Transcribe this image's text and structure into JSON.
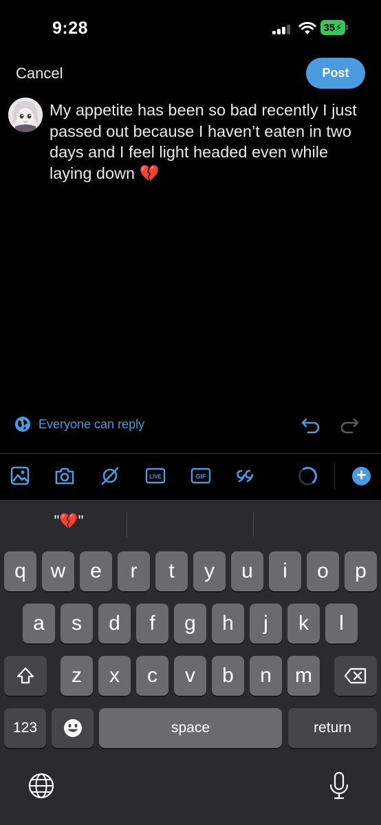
{
  "status_bar": {
    "time": "9:28",
    "battery": "35",
    "battery_color": "#35c759"
  },
  "header": {
    "cancel_label": "Cancel",
    "post_label": "Post",
    "accent_color": "#4a9be0"
  },
  "tweet": {
    "text": "My appetite has been so bad recently I just passed out because I haven’t eaten in two days and I feel light headed even while laying down 💔"
  },
  "reply_settings": {
    "label": "Everyone can reply",
    "icon": "globe-icon"
  },
  "toolbar": {
    "icons": [
      "image-icon",
      "camera-icon",
      "grok-icon",
      "live-icon",
      "gif-icon",
      "quote-icon",
      "character-counter-ring",
      "add-icon"
    ],
    "live_label": "LIVE",
    "gif_label": "GIF",
    "add_label": "+"
  },
  "keyboard": {
    "suggestions": [
      "\"💔\"",
      "",
      ""
    ],
    "row1": [
      "q",
      "w",
      "e",
      "r",
      "t",
      "y",
      "u",
      "i",
      "o",
      "p"
    ],
    "row2": [
      "a",
      "s",
      "d",
      "f",
      "g",
      "h",
      "j",
      "k",
      "l"
    ],
    "row3": [
      "z",
      "x",
      "c",
      "v",
      "b",
      "n",
      "m"
    ],
    "numbers_label": "123",
    "space_label": "space",
    "return_label": "return",
    "icons": [
      "shift-icon",
      "backspace-icon",
      "emoji-icon",
      "globe-icon",
      "microphone-icon"
    ]
  }
}
